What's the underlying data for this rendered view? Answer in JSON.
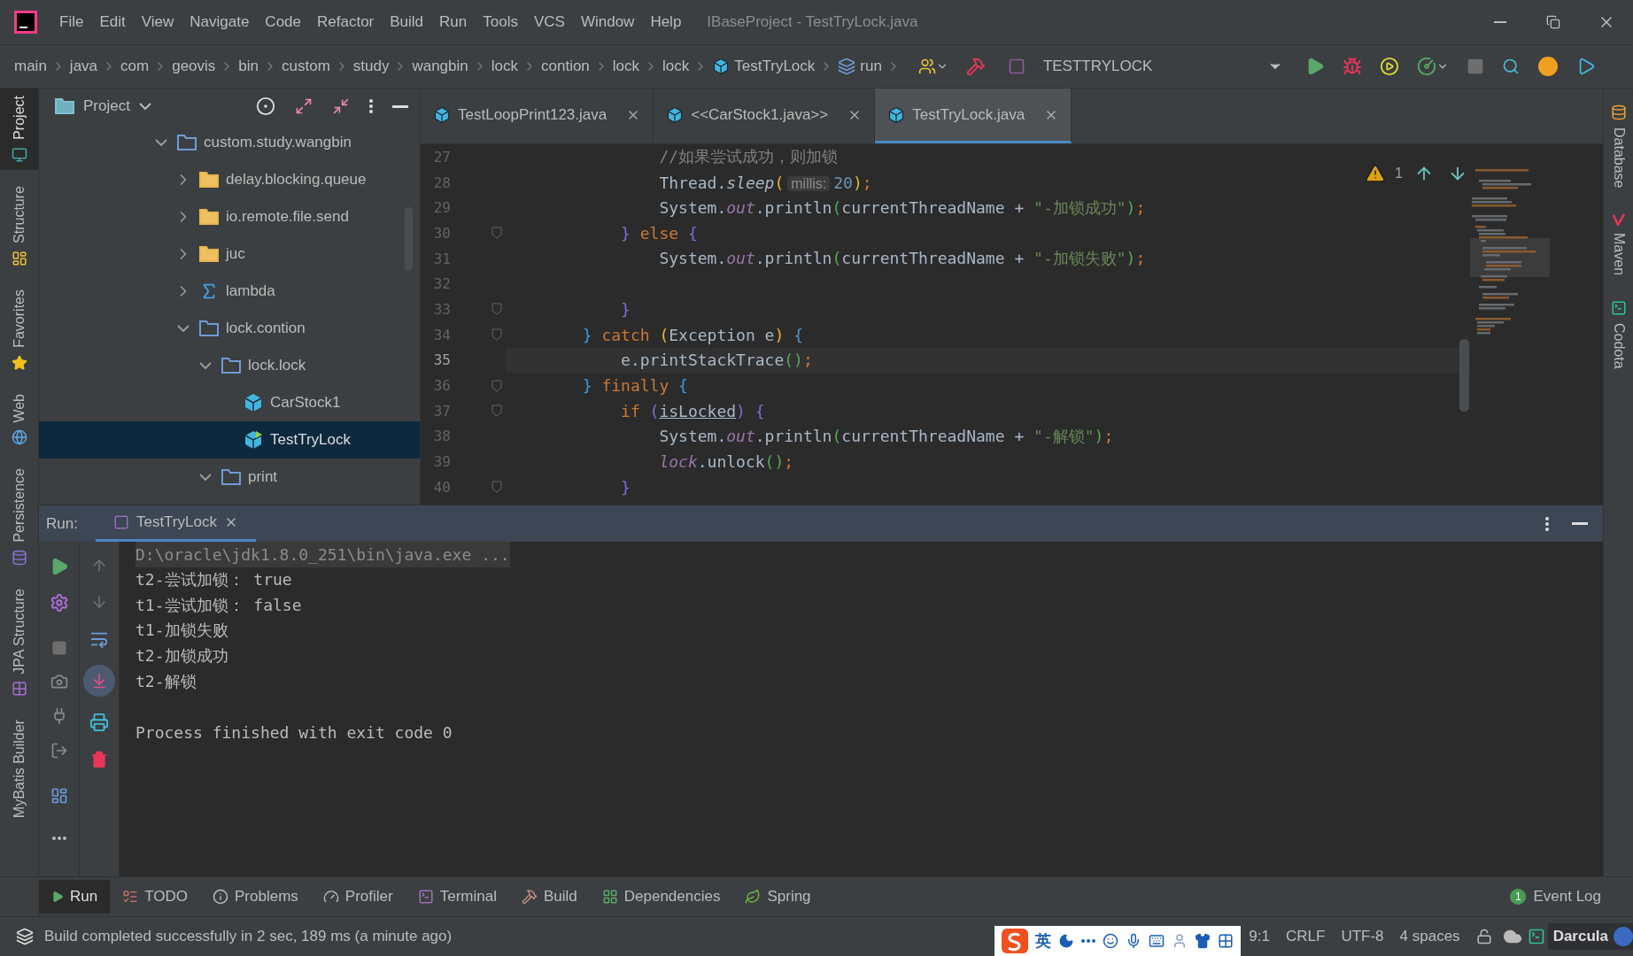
{
  "window": {
    "title": "IBaseProject - TestTryLock.java"
  },
  "menu": [
    "File",
    "Edit",
    "View",
    "Navigate",
    "Code",
    "Refactor",
    "Build",
    "Run",
    "Tools",
    "VCS",
    "Window",
    "Help"
  ],
  "breadcrumbs": [
    {
      "label": "main",
      "kind": "package"
    },
    {
      "label": "java",
      "kind": "package"
    },
    {
      "label": "com",
      "kind": "package"
    },
    {
      "label": "geovis",
      "kind": "package"
    },
    {
      "label": "bin",
      "kind": "package"
    },
    {
      "label": "custom",
      "kind": "package"
    },
    {
      "label": "study",
      "kind": "package"
    },
    {
      "label": "wangbin",
      "kind": "package"
    },
    {
      "label": "lock",
      "kind": "package"
    },
    {
      "label": "contion",
      "kind": "package"
    },
    {
      "label": "lock",
      "kind": "package"
    },
    {
      "label": "lock",
      "kind": "package"
    },
    {
      "label": "TestTryLock",
      "kind": "class"
    },
    {
      "label": "run",
      "kind": "method"
    }
  ],
  "toolbar": {
    "run_configuration": "TESTTRYLOCK"
  },
  "left_stripe": [
    {
      "label": "Project",
      "selected": true
    },
    {
      "label": "Structure",
      "selected": false
    },
    {
      "label": "Favorites",
      "selected": false
    },
    {
      "label": "Web",
      "selected": false
    },
    {
      "label": "Persistence",
      "selected": false
    },
    {
      "label": "JPA Structure",
      "selected": false
    },
    {
      "label": "MyBatis Builder",
      "selected": false
    }
  ],
  "right_stripe": [
    {
      "label": "Database",
      "selected": false
    },
    {
      "label": "Maven",
      "selected": false
    },
    {
      "label": "Codota",
      "selected": false
    }
  ],
  "project_panel": {
    "title": "Project",
    "tree": [
      {
        "label": "custom.study.wangbin",
        "kind": "package",
        "expanded": true,
        "selected": false,
        "children": [
          {
            "label": "delay.blocking.queue",
            "kind": "resource",
            "expanded": false,
            "selected": false
          },
          {
            "label": "io.remote.file.send",
            "kind": "resource",
            "expanded": false,
            "selected": false
          },
          {
            "label": "juc",
            "kind": "resource",
            "expanded": false,
            "selected": false
          },
          {
            "label": "lambda",
            "kind": "sigma",
            "expanded": false,
            "selected": false
          },
          {
            "label": "lock.contion",
            "kind": "package",
            "expanded": true,
            "selected": false,
            "children": [
              {
                "label": "lock.lock",
                "kind": "package",
                "expanded": true,
                "selected": false,
                "children": [
                  {
                    "label": "CarStock1",
                    "kind": "class",
                    "selected": false
                  },
                  {
                    "label": "TestTryLock",
                    "kind": "runnable",
                    "selected": true
                  }
                ]
              },
              {
                "label": "print",
                "kind": "package",
                "expanded": true,
                "selected": false
              }
            ]
          }
        ]
      }
    ]
  },
  "editor": {
    "tabs": [
      {
        "label": "TestLoopPrint123.java",
        "selected": false
      },
      {
        "label": "<<CarStock1.java>>",
        "selected": false
      },
      {
        "label": "TestTryLock.java",
        "selected": true
      }
    ],
    "warnings": "1",
    "lines": [
      {
        "number": "27",
        "fold": false,
        "current": false,
        "tokens": [
          {
            "kind": "comment",
            "text": "                //如果尝试成功，则加锁"
          }
        ]
      },
      {
        "number": "28",
        "fold": false,
        "current": false,
        "tokens": [
          {
            "kind": "plain",
            "text": "                Thread."
          },
          {
            "kind": "static-method",
            "text": "sleep"
          },
          {
            "kind": "bracket-3",
            "text": "("
          },
          {
            "kind": "hint",
            "text": "millis:"
          },
          {
            "kind": "number",
            "text": "20"
          },
          {
            "kind": "bracket-3",
            "text": ")"
          },
          {
            "kind": "keyword",
            "text": ";"
          }
        ]
      },
      {
        "number": "29",
        "fold": false,
        "current": false,
        "tokens": [
          {
            "kind": "plain",
            "text": "                System."
          },
          {
            "kind": "static-field",
            "text": "out"
          },
          {
            "kind": "plain",
            "text": ".println"
          },
          {
            "kind": "bracket-4",
            "text": "("
          },
          {
            "kind": "plain",
            "text": "currentThreadName + "
          },
          {
            "kind": "string",
            "text": "\"-加锁成功\""
          },
          {
            "kind": "bracket-4",
            "text": ")"
          },
          {
            "kind": "keyword",
            "text": ";"
          }
        ]
      },
      {
        "number": "30",
        "fold": true,
        "current": false,
        "tokens": [
          {
            "kind": "bracket-2",
            "text": "            }"
          },
          {
            "kind": "keyword",
            "text": " else "
          },
          {
            "kind": "bracket-2",
            "text": "{"
          }
        ]
      },
      {
        "number": "31",
        "fold": false,
        "current": false,
        "tokens": [
          {
            "kind": "plain",
            "text": "                System."
          },
          {
            "kind": "static-field",
            "text": "out"
          },
          {
            "kind": "plain",
            "text": ".println"
          },
          {
            "kind": "bracket-4",
            "text": "("
          },
          {
            "kind": "plain",
            "text": "currentThreadName + "
          },
          {
            "kind": "string",
            "text": "\"-加锁失败\""
          },
          {
            "kind": "bracket-4",
            "text": ")"
          },
          {
            "kind": "keyword",
            "text": ";"
          }
        ]
      },
      {
        "number": "32",
        "fold": false,
        "current": false
      },
      {
        "number": "33",
        "fold": true,
        "current": false,
        "tokens": [
          {
            "kind": "bracket-2",
            "text": "            }"
          }
        ]
      },
      {
        "number": "34",
        "fold": true,
        "current": false,
        "tokens": [
          {
            "kind": "bracket-1",
            "text": "        }"
          },
          {
            "kind": "keyword",
            "text": " catch "
          },
          {
            "kind": "bracket-3",
            "text": "("
          },
          {
            "kind": "plain",
            "text": "Exception e"
          },
          {
            "kind": "bracket-3",
            "text": ")"
          },
          {
            "kind": "bracket-1",
            "text": " {"
          }
        ]
      },
      {
        "number": "35",
        "fold": false,
        "current": true,
        "tokens": [
          {
            "kind": "plain",
            "text": "            e.printStackTrace"
          },
          {
            "kind": "bracket-4",
            "text": "()"
          },
          {
            "kind": "keyword",
            "text": ";"
          }
        ]
      },
      {
        "number": "36",
        "fold": true,
        "current": false,
        "tokens": [
          {
            "kind": "bracket-1",
            "text": "        }"
          },
          {
            "kind": "keyword",
            "text": " finally "
          },
          {
            "kind": "bracket-1",
            "text": "{"
          }
        ]
      },
      {
        "number": "37",
        "fold": true,
        "current": false,
        "tokens": [
          {
            "kind": "keyword",
            "text": "            if "
          },
          {
            "kind": "bracket-2",
            "text": "("
          },
          {
            "kind": "underlined",
            "text": "isLocked"
          },
          {
            "kind": "bracket-2",
            "text": ")"
          },
          {
            "kind": "bracket-2",
            "text": " {"
          }
        ]
      },
      {
        "number": "38",
        "fold": false,
        "current": false,
        "tokens": [
          {
            "kind": "plain",
            "text": "                System."
          },
          {
            "kind": "static-field",
            "text": "out"
          },
          {
            "kind": "plain",
            "text": ".println"
          },
          {
            "kind": "bracket-4",
            "text": "("
          },
          {
            "kind": "plain",
            "text": "currentThreadName + "
          },
          {
            "kind": "string",
            "text": "\"-解锁\""
          },
          {
            "kind": "bracket-4",
            "text": ")"
          },
          {
            "kind": "keyword",
            "text": ";"
          }
        ]
      },
      {
        "number": "39",
        "fold": false,
        "current": false,
        "tokens": [
          {
            "kind": "static-field",
            "text": "                lock"
          },
          {
            "kind": "plain",
            "text": ".unlock"
          },
          {
            "kind": "bracket-4",
            "text": "()"
          },
          {
            "kind": "keyword",
            "text": ";"
          }
        ]
      },
      {
        "number": "40",
        "fold": true,
        "current": false,
        "tokens": [
          {
            "kind": "bracket-2",
            "text": "            }"
          }
        ]
      }
    ]
  },
  "run_panel": {
    "label": "Run:",
    "tab": "TestTryLock",
    "console": [
      {
        "kind": "command",
        "text": "D:\\oracle\\jdk1.8.0_251\\bin\\java.exe ..."
      },
      {
        "kind": "output",
        "text": "t2-尝试加锁： true"
      },
      {
        "kind": "output",
        "text": "t1-尝试加锁： false"
      },
      {
        "kind": "output",
        "text": "t1-加锁失败"
      },
      {
        "kind": "output",
        "text": "t2-加锁成功"
      },
      {
        "kind": "output",
        "text": "t2-解锁"
      },
      {
        "kind": "blank"
      },
      {
        "kind": "output",
        "text": "Process finished with exit code 0"
      }
    ]
  },
  "tool_windows": [
    {
      "label": "Run",
      "selected": true
    },
    {
      "label": "TODO",
      "selected": false
    },
    {
      "label": "Problems",
      "selected": false
    },
    {
      "label": "Profiler",
      "selected": false
    },
    {
      "label": "Terminal",
      "selected": false
    },
    {
      "label": "Build",
      "selected": false
    },
    {
      "label": "Dependencies",
      "selected": false
    },
    {
      "label": "Spring",
      "selected": false
    }
  ],
  "event_log": {
    "label": "Event Log",
    "count": "1"
  },
  "status_bar": {
    "message": "Build completed successfully in 2 sec, 189 ms (a minute ago)",
    "ime": "英",
    "position": "9:1",
    "line_separator": "CRLF",
    "encoding": "UTF-8",
    "indent": "4 spaces",
    "theme": "Darcula"
  }
}
